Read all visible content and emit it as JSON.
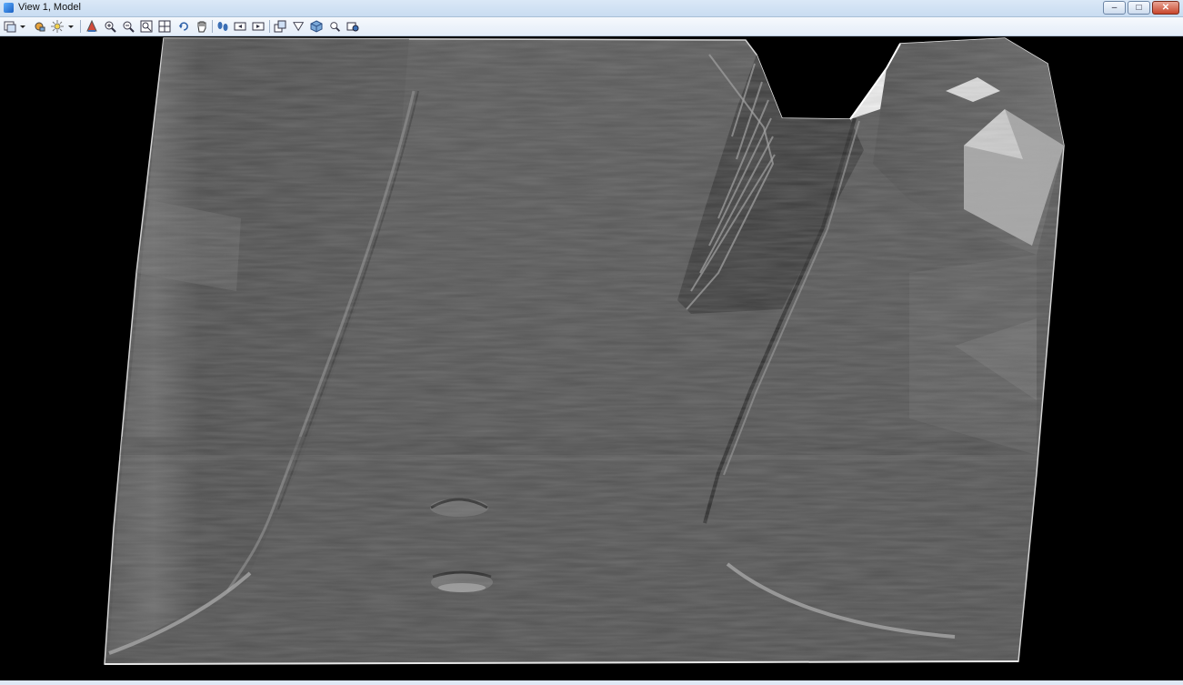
{
  "window": {
    "title": "View 1, Model",
    "controls": {
      "minimize": "–",
      "maximize": "□",
      "close": "✕"
    }
  },
  "toolbar": {
    "buttons": [
      {
        "icon": "view-attributes-icon"
      },
      {
        "icon": "dropdown-arrow-icon"
      },
      {
        "icon": "display-style-icon"
      },
      {
        "icon": "lighting-icon"
      },
      {
        "icon": "dropdown-arrow-icon"
      },
      {
        "icon": "update-view-icon"
      },
      {
        "icon": "zoom-in-icon"
      },
      {
        "icon": "zoom-out-icon"
      },
      {
        "icon": "window-area-icon"
      },
      {
        "icon": "fit-view-icon"
      },
      {
        "icon": "rotate-view-icon"
      },
      {
        "icon": "pan-view-icon"
      },
      {
        "icon": "walk-icon"
      },
      {
        "icon": "view-previous-icon"
      },
      {
        "icon": "view-next-icon"
      },
      {
        "icon": "camera-icon"
      },
      {
        "icon": "clip-volume-icon"
      },
      {
        "icon": "view-cube-icon"
      },
      {
        "icon": "clip-mask-icon"
      },
      {
        "icon": "view-toggles-icon"
      }
    ]
  },
  "colors": {
    "viewport_background": "#000000",
    "terrain": "#5a5a5a",
    "chrome": "#dfe9f5"
  }
}
